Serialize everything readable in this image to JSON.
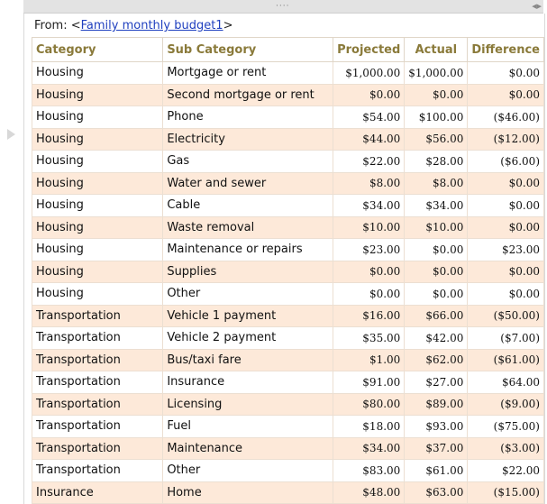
{
  "link": {
    "prefix": "From: <",
    "name": "Family monthly budget1",
    "suffix": ">"
  },
  "table": {
    "headers": [
      "Category",
      "Sub Category",
      "Projected",
      "Actual",
      "Difference"
    ],
    "rows": [
      [
        "Housing",
        "Mortgage or rent",
        "$1,000.00",
        "$1,000.00",
        "$0.00"
      ],
      [
        "Housing",
        "Second mortgage or rent",
        "$0.00",
        "$0.00",
        "$0.00"
      ],
      [
        "Housing",
        "Phone",
        "$54.00",
        "$100.00",
        "($46.00)"
      ],
      [
        "Housing",
        "Electricity",
        "$44.00",
        "$56.00",
        "($12.00)"
      ],
      [
        "Housing",
        "Gas",
        "$22.00",
        "$28.00",
        "($6.00)"
      ],
      [
        "Housing",
        "Water and sewer",
        "$8.00",
        "$8.00",
        "$0.00"
      ],
      [
        "Housing",
        "Cable",
        "$34.00",
        "$34.00",
        "$0.00"
      ],
      [
        "Housing",
        "Waste removal",
        "$10.00",
        "$10.00",
        "$0.00"
      ],
      [
        "Housing",
        "Maintenance or repairs",
        "$23.00",
        "$0.00",
        "$23.00"
      ],
      [
        "Housing",
        "Supplies",
        "$0.00",
        "$0.00",
        "$0.00"
      ],
      [
        "Housing",
        "Other",
        "$0.00",
        "$0.00",
        "$0.00"
      ],
      [
        "Transportation",
        "Vehicle 1 payment",
        "$16.00",
        "$66.00",
        "($50.00)"
      ],
      [
        "Transportation",
        "Vehicle 2 payment",
        "$35.00",
        "$42.00",
        "($7.00)"
      ],
      [
        "Transportation",
        "Bus/taxi fare",
        "$1.00",
        "$62.00",
        "($61.00)"
      ],
      [
        "Transportation",
        "Insurance",
        "$91.00",
        "$27.00",
        "$64.00"
      ],
      [
        "Transportation",
        "Licensing",
        "$80.00",
        "$89.00",
        "($9.00)"
      ],
      [
        "Transportation",
        "Fuel",
        "$18.00",
        "$93.00",
        "($75.00)"
      ],
      [
        "Transportation",
        "Maintenance",
        "$34.00",
        "$37.00",
        "($3.00)"
      ],
      [
        "Transportation",
        "Other",
        "$83.00",
        "$61.00",
        "$22.00"
      ],
      [
        "Insurance",
        "Home",
        "$48.00",
        "$63.00",
        "($15.00)"
      ]
    ]
  }
}
